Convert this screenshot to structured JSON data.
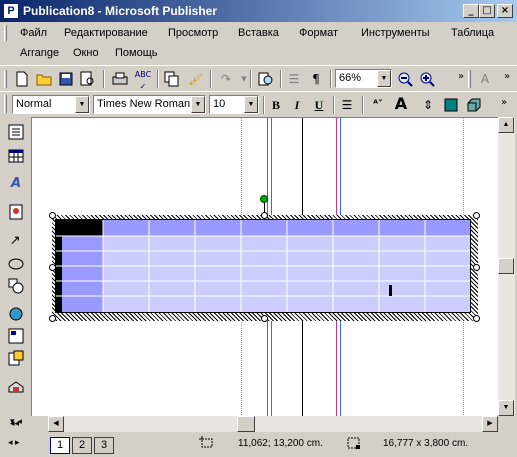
{
  "window": {
    "title": "Publication8 - Microsoft Publisher",
    "app_icon": "P",
    "controls": {
      "minimize": "_",
      "maximize": "□",
      "close": "×"
    }
  },
  "menu": {
    "items": [
      "Файл",
      "Редактирование",
      "Просмотр",
      "Вставка",
      "Формат",
      "Инструменты",
      "Таблица",
      "Arrange",
      "Окно",
      "Помощь"
    ]
  },
  "toolbar_standard": {
    "zoom_value": "66%",
    "icons": [
      "new-icon",
      "open-icon",
      "save-icon",
      "print-preview-icon",
      "print-icon",
      "spellcheck-icon",
      "copy-icon",
      "format-painter-icon",
      "redo-icon",
      "zoom-page-icon",
      "columns-icon",
      "pilcrow-icon",
      "zoom-out-icon",
      "zoom-in-icon"
    ]
  },
  "toolbar_formatting": {
    "style_value": "Normal",
    "font_value": "Times New Roman",
    "size_value": "10",
    "bold": "B",
    "italic": "I",
    "underline": "U"
  },
  "status": {
    "position": "11,062; 13,200 cm.",
    "size": "16,777 x 3,800 cm.",
    "pages": [
      "1",
      "2",
      "3"
    ],
    "current_page": "1"
  },
  "colors": {
    "title_start": "#0a246a",
    "title_end": "#a6caf0",
    "table_fill": "#ccccff",
    "table_header": "#9999ff",
    "guide_blue": "#3366ff",
    "guide_pink": "#cc3399",
    "selection_handle": "#00aa00"
  }
}
